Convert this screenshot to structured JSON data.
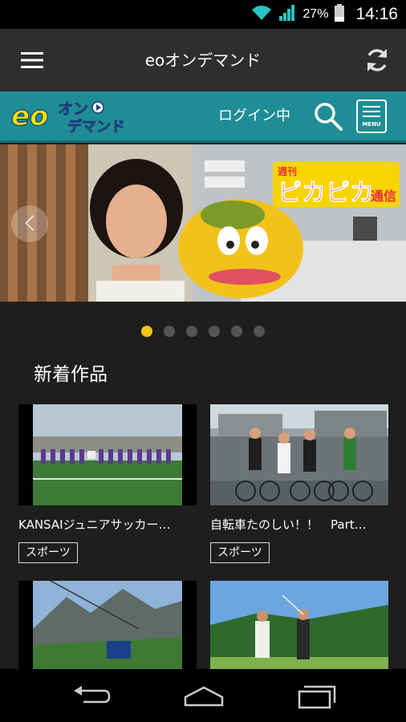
{
  "status_bar": {
    "battery_text": "27%",
    "time": "14:16",
    "icons": [
      "wifi-icon",
      "signal-icon",
      "battery-icon"
    ]
  },
  "app_bar": {
    "title": "eoオンデマンド",
    "menu_icon": "hamburger-menu-icon",
    "refresh_icon": "refresh-icon"
  },
  "brand_bar": {
    "logo_text_eo": "eo",
    "logo_text_on": "オン",
    "logo_text_demand": "デマンド",
    "login_status": "ログイン中",
    "menu_label": "MENU"
  },
  "banner": {
    "show_title": "週刊ピカピカ通信",
    "title_small": "週刊",
    "title_main": "ピカピカ",
    "title_end": "通信",
    "slide_count": 6,
    "active_slide": 1
  },
  "section": {
    "title": "新着作品"
  },
  "cards": [
    {
      "title": "KANSAIジュニアサッカー…",
      "tag": "スポーツ"
    },
    {
      "title": "自転車たのしい！！　Part…",
      "tag": "スポーツ"
    },
    {
      "title": "",
      "tag": ""
    },
    {
      "title": "",
      "tag": ""
    }
  ],
  "nav_bar": {
    "icons": [
      "back-icon",
      "home-icon",
      "recent-apps-icon"
    ]
  },
  "colors": {
    "brand_teal": "#1f8d95",
    "active_dot": "#f0c419",
    "app_bar": "#2e2e2e",
    "background": "#1e1e1e"
  }
}
